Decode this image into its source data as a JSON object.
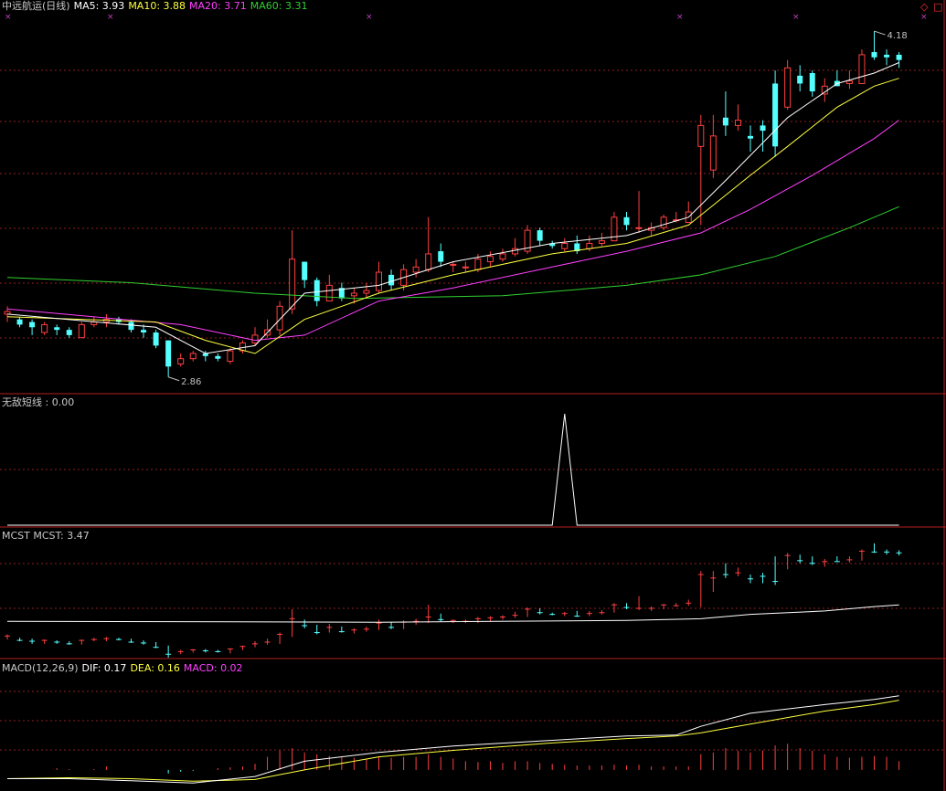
{
  "header": {
    "stock": "中远航运(日线)",
    "ma5_label": "MA5: 3.93",
    "ma10_label": "MA10: 3.88",
    "ma20_label": "MA20: 3.71",
    "ma60_label": "MA60: 3.31"
  },
  "panels": {
    "wudi_label": "无敌短线 : 0.00",
    "mcst_label": "MCST  MCST: 3.47",
    "macd_label": "MACD(12,26,9)",
    "dif_label": "DIF: 0.17",
    "dea_label": "DEA: 0.16",
    "macd_val_label": "MACD: 0.02"
  },
  "annotations": {
    "high": "4.18",
    "low": "2.86"
  },
  "colors": {
    "up": "#ff4040",
    "down": "#54ffff",
    "ma5": "#ffffff",
    "ma10": "#ffff40",
    "ma20": "#ff40ff",
    "ma60": "#30d030",
    "grid": "#902020",
    "frame": "#b02020"
  },
  "chart_data": [
    {
      "type": "candlestick",
      "title": "中远航运(日线)",
      "ylim": [
        2.8,
        4.25
      ],
      "candles": [
        [
          3.1,
          3.11,
          3.13,
          3.07
        ],
        [
          3.08,
          3.06,
          3.09,
          3.05
        ],
        [
          3.07,
          3.05,
          3.08,
          3.02
        ],
        [
          3.03,
          3.06,
          3.07,
          3.02
        ],
        [
          3.05,
          3.04,
          3.06,
          3.02
        ],
        [
          3.04,
          3.02,
          3.05,
          3.01
        ],
        [
          3.01,
          3.06,
          3.07,
          3.01
        ],
        [
          3.06,
          3.07,
          3.09,
          3.05
        ],
        [
          3.07,
          3.08,
          3.1,
          3.05
        ],
        [
          3.08,
          3.07,
          3.09,
          3.06
        ],
        [
          3.07,
          3.04,
          3.08,
          3.03
        ],
        [
          3.04,
          3.03,
          3.06,
          3.01
        ],
        [
          3.03,
          2.98,
          3.04,
          2.97
        ],
        [
          3.0,
          2.9,
          3.0,
          2.86
        ],
        [
          2.91,
          2.93,
          2.95,
          2.9
        ],
        [
          2.93,
          2.95,
          2.96,
          2.92
        ],
        [
          2.95,
          2.94,
          2.96,
          2.92
        ],
        [
          2.94,
          2.93,
          2.95,
          2.92
        ],
        [
          2.92,
          2.96,
          2.97,
          2.91
        ],
        [
          2.96,
          2.99,
          3.0,
          2.95
        ],
        [
          2.99,
          3.02,
          3.05,
          2.98
        ],
        [
          3.02,
          3.04,
          3.08,
          3.01
        ],
        [
          3.04,
          3.13,
          3.15,
          3.02
        ],
        [
          3.12,
          3.31,
          3.42,
          3.1
        ],
        [
          3.3,
          3.23,
          3.3,
          3.2
        ],
        [
          3.23,
          3.15,
          3.24,
          3.13
        ],
        [
          3.15,
          3.21,
          3.25,
          3.15
        ],
        [
          3.2,
          3.16,
          3.22,
          3.15
        ],
        [
          3.17,
          3.18,
          3.2,
          3.14
        ],
        [
          3.18,
          3.19,
          3.22,
          3.16
        ],
        [
          3.19,
          3.26,
          3.3,
          3.18
        ],
        [
          3.25,
          3.21,
          3.27,
          3.19
        ],
        [
          3.21,
          3.27,
          3.29,
          3.19
        ],
        [
          3.26,
          3.28,
          3.31,
          3.24
        ],
        [
          3.27,
          3.33,
          3.47,
          3.26
        ],
        [
          3.34,
          3.3,
          3.37,
          3.28
        ],
        [
          3.29,
          3.29,
          3.3,
          3.26
        ],
        [
          3.28,
          3.28,
          3.3,
          3.26
        ],
        [
          3.27,
          3.31,
          3.33,
          3.26
        ],
        [
          3.3,
          3.32,
          3.34,
          3.28
        ],
        [
          3.31,
          3.33,
          3.35,
          3.3
        ],
        [
          3.33,
          3.35,
          3.39,
          3.32
        ],
        [
          3.34,
          3.42,
          3.44,
          3.33
        ],
        [
          3.42,
          3.38,
          3.43,
          3.36
        ],
        [
          3.37,
          3.36,
          3.38,
          3.35
        ],
        [
          3.35,
          3.37,
          3.39,
          3.34
        ],
        [
          3.37,
          3.34,
          3.4,
          3.33
        ],
        [
          3.35,
          3.37,
          3.4,
          3.34
        ],
        [
          3.37,
          3.38,
          3.41,
          3.36
        ],
        [
          3.38,
          3.47,
          3.49,
          3.38
        ],
        [
          3.47,
          3.44,
          3.49,
          3.42
        ],
        [
          3.43,
          3.43,
          3.57,
          3.41
        ],
        [
          3.42,
          3.43,
          3.45,
          3.4
        ],
        [
          3.43,
          3.47,
          3.48,
          3.42
        ],
        [
          3.46,
          3.46,
          3.49,
          3.45
        ],
        [
          3.45,
          3.49,
          3.53,
          3.46
        ],
        [
          3.74,
          3.82,
          3.86,
          3.44
        ],
        [
          3.65,
          3.78,
          3.86,
          3.62
        ],
        [
          3.85,
          3.82,
          3.95,
          3.78
        ],
        [
          3.82,
          3.84,
          3.9,
          3.8
        ],
        [
          3.78,
          3.77,
          3.82,
          3.72
        ],
        [
          3.82,
          3.8,
          3.84,
          3.72
        ],
        [
          3.98,
          3.74,
          4.03,
          3.7
        ],
        [
          3.89,
          4.04,
          4.07,
          3.88
        ],
        [
          4.01,
          3.98,
          4.05,
          3.95
        ],
        [
          4.02,
          3.95,
          4.03,
          3.93
        ],
        [
          3.94,
          3.97,
          4.0,
          3.91
        ],
        [
          3.99,
          3.97,
          4.03,
          3.97
        ],
        [
          3.98,
          3.99,
          4.03,
          3.96
        ],
        [
          3.98,
          4.09,
          4.11,
          3.98
        ],
        [
          4.1,
          4.08,
          4.18,
          4.07
        ],
        [
          4.09,
          4.08,
          4.11,
          4.05
        ],
        [
          4.09,
          4.07,
          4.1,
          4.04
        ]
      ],
      "ma5": [
        [
          0,
          3.1
        ],
        [
          12,
          3.05
        ],
        [
          16,
          2.95
        ],
        [
          20,
          2.98
        ],
        [
          24,
          3.18
        ],
        [
          30,
          3.21
        ],
        [
          36,
          3.3
        ],
        [
          44,
          3.37
        ],
        [
          50,
          3.4
        ],
        [
          55,
          3.47
        ],
        [
          58,
          3.61
        ],
        [
          63,
          3.85
        ],
        [
          67,
          3.98
        ],
        [
          70,
          4.02
        ],
        [
          72,
          4.06
        ]
      ],
      "ma10": [
        [
          0,
          3.09
        ],
        [
          12,
          3.07
        ],
        [
          16,
          3.0
        ],
        [
          20,
          2.95
        ],
        [
          24,
          3.08
        ],
        [
          30,
          3.18
        ],
        [
          36,
          3.25
        ],
        [
          44,
          3.33
        ],
        [
          50,
          3.37
        ],
        [
          55,
          3.44
        ],
        [
          60,
          3.63
        ],
        [
          63,
          3.74
        ],
        [
          67,
          3.89
        ],
        [
          70,
          3.97
        ],
        [
          72,
          4.0
        ]
      ],
      "ma20": [
        [
          0,
          3.12
        ],
        [
          14,
          3.06
        ],
        [
          20,
          3.0
        ],
        [
          24,
          3.02
        ],
        [
          30,
          3.15
        ],
        [
          36,
          3.2
        ],
        [
          44,
          3.28
        ],
        [
          50,
          3.34
        ],
        [
          56,
          3.41
        ],
        [
          60,
          3.5
        ],
        [
          65,
          3.63
        ],
        [
          70,
          3.77
        ],
        [
          72,
          3.84
        ]
      ],
      "ma60": [
        [
          0,
          3.24
        ],
        [
          10,
          3.22
        ],
        [
          20,
          3.18
        ],
        [
          28,
          3.16
        ],
        [
          40,
          3.17
        ],
        [
          50,
          3.21
        ],
        [
          56,
          3.25
        ],
        [
          62,
          3.32
        ],
        [
          68,
          3.43
        ],
        [
          72,
          3.51
        ]
      ]
    },
    {
      "type": "line",
      "title": "无敌短线",
      "ylim": [
        0,
        1
      ],
      "x": [
        0,
        44,
        45,
        46,
        72
      ],
      "y": [
        0,
        0,
        1,
        0,
        0
      ]
    },
    {
      "type": "candlestick",
      "title": "MCST",
      "ylim": [
        2.85,
        4.2
      ],
      "mcst": [
        [
          0,
          3.28
        ],
        [
          30,
          3.27
        ],
        [
          50,
          3.29
        ],
        [
          56,
          3.31
        ],
        [
          60,
          3.36
        ],
        [
          66,
          3.4
        ],
        [
          70,
          3.45
        ],
        [
          72,
          3.47
        ]
      ]
    },
    {
      "type": "bar",
      "title": "MACD(12,26,9)",
      "ylim": [
        -0.04,
        0.22
      ],
      "dif": [
        [
          0,
          -0.02
        ],
        [
          5,
          -0.02
        ],
        [
          10,
          -0.025
        ],
        [
          15,
          -0.03
        ],
        [
          20,
          -0.015
        ],
        [
          24,
          0.02
        ],
        [
          30,
          0.04
        ],
        [
          36,
          0.055
        ],
        [
          44,
          0.068
        ],
        [
          50,
          0.078
        ],
        [
          54,
          0.08
        ],
        [
          56,
          0.1
        ],
        [
          60,
          0.13
        ],
        [
          66,
          0.15
        ],
        [
          70,
          0.162
        ],
        [
          72,
          0.17
        ]
      ],
      "dea": [
        [
          0,
          -0.02
        ],
        [
          5,
          -0.018
        ],
        [
          10,
          -0.02
        ],
        [
          15,
          -0.026
        ],
        [
          20,
          -0.022
        ],
        [
          24,
          0.0
        ],
        [
          30,
          0.03
        ],
        [
          36,
          0.045
        ],
        [
          44,
          0.062
        ],
        [
          50,
          0.072
        ],
        [
          54,
          0.078
        ],
        [
          56,
          0.085
        ],
        [
          60,
          0.105
        ],
        [
          66,
          0.135
        ],
        [
          70,
          0.15
        ],
        [
          72,
          0.16
        ]
      ],
      "macd": [
        0,
        0,
        0,
        0,
        0.004,
        0.002,
        0,
        0.002,
        0.008,
        0,
        0,
        0,
        0,
        -0.008,
        -0.004,
        -0.002,
        0,
        0.004,
        0.006,
        0.008,
        0.014,
        0.03,
        0.045,
        0.05,
        0.04,
        0.036,
        0.032,
        0.03,
        0.028,
        0.026,
        0.03,
        0.028,
        0.03,
        0.03,
        0.036,
        0.03,
        0.026,
        0.02,
        0.018,
        0.02,
        0.016,
        0.02,
        0.02,
        0.016,
        0.014,
        0.012,
        0.01,
        0.01,
        0.01,
        0.012,
        0.01,
        0.012,
        0.008,
        0.008,
        0.008,
        0.008,
        0.036,
        0.04,
        0.05,
        0.044,
        0.04,
        0.044,
        0.056,
        0.06,
        0.05,
        0.044,
        0.036,
        0.03,
        0.028,
        0.03,
        0.032,
        0.03,
        0.02
      ]
    }
  ]
}
